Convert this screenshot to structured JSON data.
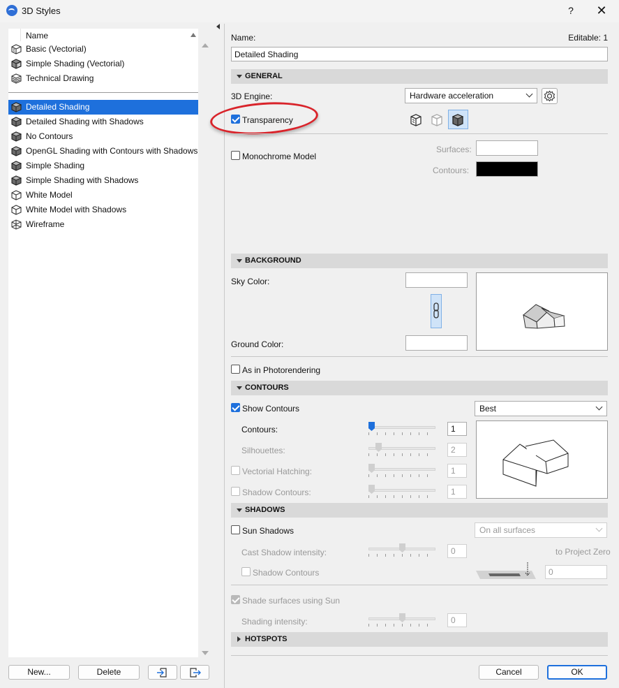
{
  "window": {
    "title": "3D Styles",
    "help": "?",
    "close": "✕"
  },
  "list": {
    "header": "Name",
    "items": [
      {
        "label": "Basic (Vectorial)",
        "icon": "vectorial-box-icon"
      },
      {
        "label": "Simple Shading (Vectorial)",
        "icon": "vectorial-shaded-icon"
      },
      {
        "label": "Technical Drawing",
        "icon": "vectorial-hatch-icon"
      },
      {
        "label": "Detailed Shading",
        "icon": "shaded-box-icon",
        "selected": true
      },
      {
        "label": "Detailed Shading with Shadows",
        "icon": "shaded-box-icon"
      },
      {
        "label": "No Contours",
        "icon": "shaded-box-icon"
      },
      {
        "label": "OpenGL Shading with Contours with Shadows",
        "icon": "shaded-box-icon"
      },
      {
        "label": "Simple Shading",
        "icon": "shaded-box-icon"
      },
      {
        "label": "Simple Shading with Shadows",
        "icon": "shaded-box-icon"
      },
      {
        "label": "White Model",
        "icon": "white-box-icon"
      },
      {
        "label": "White Model with Shadows",
        "icon": "white-box-icon"
      },
      {
        "label": "Wireframe",
        "icon": "wireframe-box-icon"
      }
    ]
  },
  "buttons": {
    "new": "New...",
    "delete": "Delete",
    "cancel": "Cancel",
    "ok": "OK"
  },
  "name": {
    "label": "Name:",
    "editable": "Editable: 1",
    "value": "Detailed Shading"
  },
  "general": {
    "title": "GENERAL",
    "engine_label": "3D Engine:",
    "engine_value": "Hardware acceleration",
    "transparency": "Transparency",
    "monochrome": "Monochrome Model",
    "surfaces": "Surfaces:",
    "contours": "Contours:",
    "contour_color": "#000000"
  },
  "background": {
    "title": "BACKGROUND",
    "sky": "Sky Color:",
    "ground": "Ground Color:",
    "photorender": "As in Photorendering"
  },
  "contours": {
    "title": "CONTOURS",
    "show": "Show Contours",
    "quality": "Best",
    "contours_label": "Contours:",
    "contours_value": "1",
    "silhouettes_label": "Silhouettes:",
    "silhouettes_value": "2",
    "vectorial_label": "Vectorial Hatching:",
    "vectorial_value": "1",
    "shadow_label": "Shadow Contours:",
    "shadow_value": "1"
  },
  "shadows": {
    "title": "SHADOWS",
    "sun": "Sun Shadows",
    "surfaces_option": "On all surfaces",
    "cast_label": "Cast Shadow intensity:",
    "cast_value": "0",
    "to_project_zero": "to Project Zero",
    "shadow_contours": "Shadow Contours",
    "project_zero_value": "0",
    "shade_sun": "Shade surfaces using Sun",
    "shading_intensity": "Shading intensity:",
    "shading_value": "0"
  },
  "hotspots": {
    "title": "HOTSPOTS"
  },
  "colors": {
    "accent": "#1e70dc",
    "annotation": "#d9232a"
  }
}
